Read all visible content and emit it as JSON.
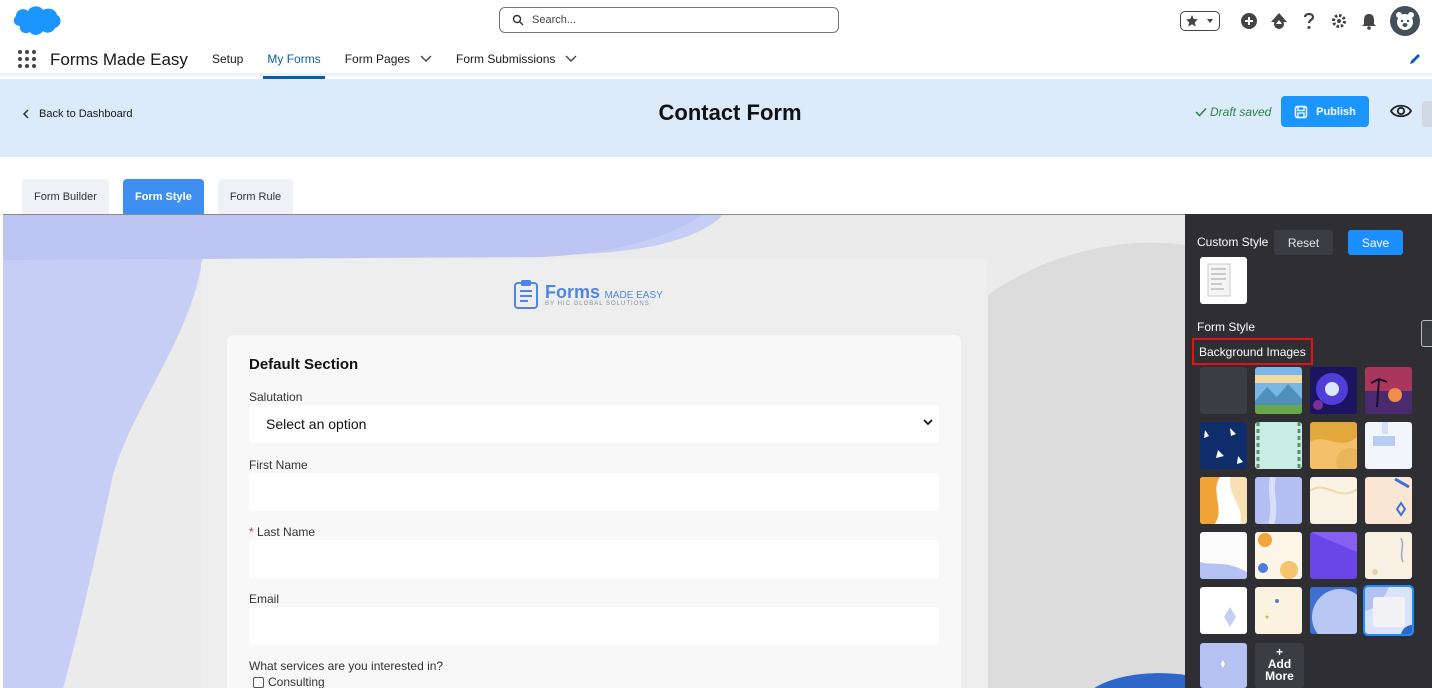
{
  "header": {
    "search_placeholder": "Search...",
    "icons": [
      "salesforce-logo",
      "search-icon",
      "favorites-star-icon",
      "add-icon",
      "trailhead-icon",
      "help-icon",
      "setup-gear-icon",
      "notifications-bell-icon",
      "user-avatar"
    ]
  },
  "nav": {
    "app_name": "Forms Made Easy",
    "items": [
      {
        "label": "Setup",
        "active": false,
        "dropdown": false
      },
      {
        "label": "My Forms",
        "active": true,
        "dropdown": false
      },
      {
        "label": "Form Pages",
        "active": false,
        "dropdown": true
      },
      {
        "label": "Form Submissions",
        "active": false,
        "dropdown": true
      }
    ]
  },
  "page": {
    "back_label": "Back to Dashboard",
    "title": "Contact Form",
    "draft_status": "Draft saved",
    "publish_label": "Publish"
  },
  "tabs": [
    {
      "label": "Form Builder",
      "active": false
    },
    {
      "label": "Form Style",
      "active": true
    },
    {
      "label": "Form Rule",
      "active": false
    }
  ],
  "form": {
    "logo_main": "Forms",
    "logo_sub": "MADE EASY",
    "logo_by": "BY HIC GLOBAL SOLUTIONS",
    "section_title": "Default Section",
    "fields": {
      "salutation_label": "Salutation",
      "salutation_value": "Select an option",
      "first_name_label": "First Name",
      "last_name_required": "*",
      "last_name_label": "Last Name",
      "email_label": "Email",
      "services_label": "What services are you interested in?",
      "consulting_label": "Consulting"
    }
  },
  "panel": {
    "custom_style_label": "Custom Style",
    "reset_label": "Reset",
    "save_label": "Save",
    "form_style_label": "Form Style",
    "background_images_label": "Background Images",
    "add_more_plus": "+",
    "add_more_line1": "Add",
    "add_more_line2": "More",
    "selected_background_index": 19
  },
  "colors": {
    "brand_blue": "#1b96ff",
    "header_bg": "#dcebfa",
    "active_tab": "#3f8ff0",
    "panel_bg": "#2f2f33",
    "draft_green": "#2e844a",
    "highlight_red": "#e0121b"
  }
}
